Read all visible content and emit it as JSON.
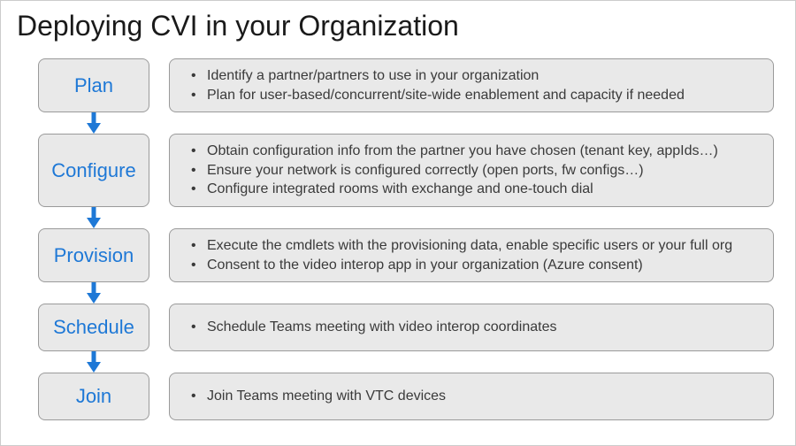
{
  "page_title": "Deploying CVI in your Organization",
  "steps": [
    {
      "label": "Plan",
      "details": [
        "Identify a partner/partners to use in your organization",
        "Plan for user-based/concurrent/site-wide enablement and capacity if needed"
      ]
    },
    {
      "label": "Configure",
      "details": [
        "Obtain configuration info from the partner you have chosen (tenant key, appIds…)",
        "Ensure your network is configured correctly (open ports, fw configs…)",
        "Configure integrated rooms with exchange and one-touch dial"
      ]
    },
    {
      "label": "Provision",
      "details": [
        "Execute the cmdlets with the provisioning data, enable specific users or your full org",
        "Consent to the video interop app in your organization (Azure consent)"
      ]
    },
    {
      "label": "Schedule",
      "details": [
        "Schedule Teams meeting with video interop coordinates"
      ]
    },
    {
      "label": "Join",
      "details": [
        "Join Teams meeting with VTC devices"
      ]
    }
  ],
  "colors": {
    "step_text": "#1e78d6",
    "arrow": "#1e78d6",
    "box_fill": "#e9e9e9",
    "box_border": "#9a9a9a"
  }
}
